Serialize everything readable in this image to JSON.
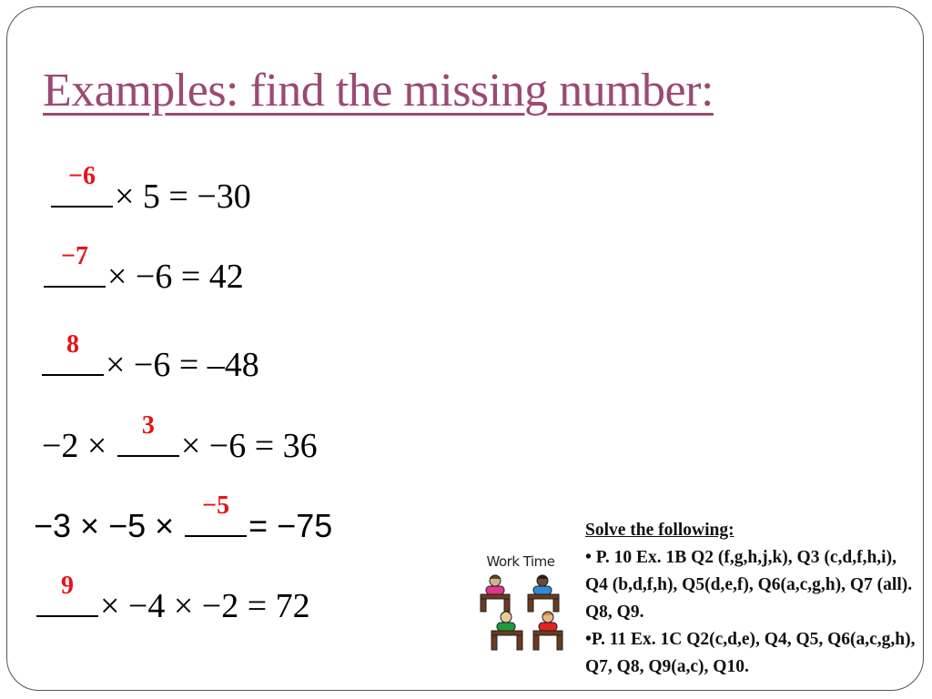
{
  "slide": {
    "title": "Examples: find the missing number:",
    "equations": [
      {
        "parts": [
          "",
          "× 5 = −30"
        ],
        "answer": "−6"
      },
      {
        "parts": [
          "",
          "× −6 = 42"
        ],
        "answer": "−7"
      },
      {
        "parts": [
          "",
          "× −6 = –48"
        ],
        "answer": "8"
      },
      {
        "parts": [
          "−2 × ",
          "× −6 = 36"
        ],
        "answer": "3"
      },
      {
        "parts": [
          "−3 × −5 × ",
          "= −75"
        ],
        "answer": "−5"
      },
      {
        "parts": [
          "",
          "× −4 × −2 = 72"
        ],
        "answer": "9"
      }
    ],
    "work_time": {
      "label": "Work Time",
      "icon": "students-at-desks-icon"
    },
    "tasks": {
      "heading": "Solve the following:",
      "lines": [
        "• P. 10 Ex. 1B Q2 (f,g,h,j,k), Q3 (c,d,f,h,i), Q4 (b,d,f,h), Q5(d,e,f), Q6(a,c,g,h), Q7 (all). Q8, Q9.",
        "•P. 11 Ex. 1C Q2(c,d,e), Q4, Q5, Q6(a,c,g,h), Q7, Q8, Q9(a,c), Q10."
      ]
    },
    "colors": {
      "title": "#9b4a72",
      "answer": "#e8121a",
      "text": "#000000"
    }
  }
}
